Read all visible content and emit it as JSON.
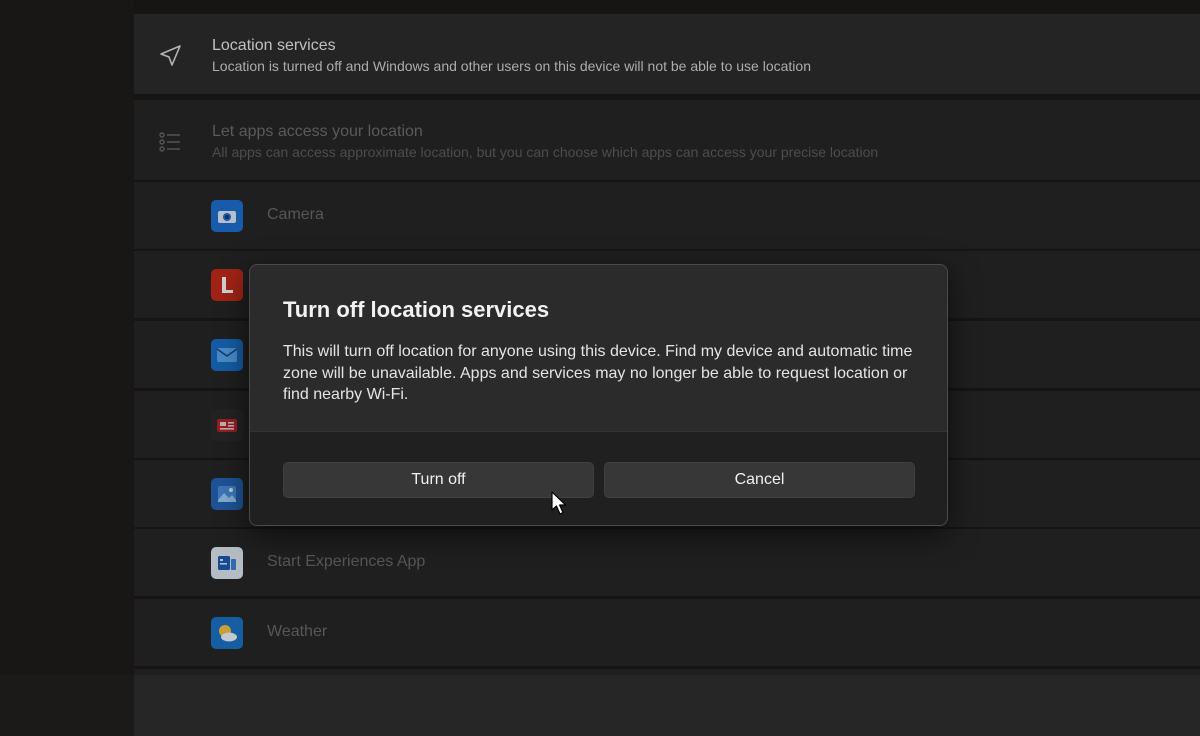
{
  "location_services": {
    "title": "Location services",
    "subtitle": "Location is turned off and Windows and other users on this device will not be able to use location",
    "icon": "location-arrow-icon"
  },
  "let_apps": {
    "title": "Let apps access your location",
    "subtitle": "All apps can access approximate location, but you can choose which apps can access your precise location",
    "icon": "list-icon"
  },
  "apps": [
    {
      "label": "Camera",
      "icon": "camera-app-icon",
      "color": "#1e6fd0"
    },
    {
      "label": "",
      "icon": "l-app-icon",
      "color": "#c42b1c"
    },
    {
      "label": "",
      "icon": "mail-app-icon",
      "color": "#1a6fc9"
    },
    {
      "label": "",
      "icon": "news-app-icon",
      "color": "#b3262e"
    },
    {
      "label": "",
      "icon": "photos-app-icon",
      "color": "#2566b8"
    },
    {
      "label": "Start Experiences App",
      "icon": "start-experiences-app-icon",
      "color": "#1d5bb0"
    },
    {
      "label": "Weather",
      "icon": "weather-app-icon",
      "color": "#1b73c8"
    }
  ],
  "dialog": {
    "title": "Turn off location services",
    "body": "This will turn off location for anyone using this device. Find my device and automatic time zone will be unavailable. Apps and services may no longer be able to request location or find nearby Wi-Fi.",
    "primary_button": "Turn off",
    "secondary_button": "Cancel"
  }
}
